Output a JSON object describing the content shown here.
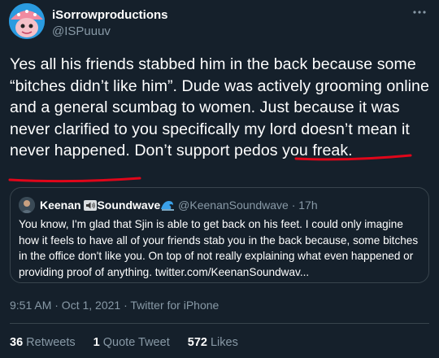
{
  "author": {
    "display_name": "iSorrowproductions",
    "handle": "@ISPuuuv"
  },
  "tweet": {
    "text_part1": "Yes all his friends stabbed him in the back because some “bitches didn’t like him”. Dude was actively grooming online and a general scumbag to women. Just because it was never clarified to you specifically my lord doesn’t mean it never happened. ",
    "text_highlight": "Don’t support pedos you freak.",
    "timestamp": "9:51 AM · Oct 1, 2021 · Twitter for iPhone"
  },
  "quoted": {
    "name_part1": "Keenan",
    "name_part2": "Soundwave",
    "handle_time": "@KeenanSoundwave · 17h",
    "text": "You know, I'm glad that Sjin is able to get back on his feet. I could only imagine how it feels to have all of your friends stab you in the back because, some bitches in the office don't like you. On top of not really explaining what even happened or providing proof of anything. twitter.com/KeenanSoundwav..."
  },
  "stats": {
    "retweets_count": "36",
    "retweets_label": "Retweets",
    "quotes_count": "1",
    "quotes_label": "Quote Tweet",
    "likes_count": "572",
    "likes_label": "Likes"
  },
  "colors": {
    "background": "#15202b",
    "secondary_text": "#8899a6",
    "border": "#38444d",
    "annotation": "#e0061a"
  },
  "icons": {
    "more": "more-horizontal-icon",
    "speaker": "speaker-icon",
    "wave": "wave-emoji-icon"
  }
}
